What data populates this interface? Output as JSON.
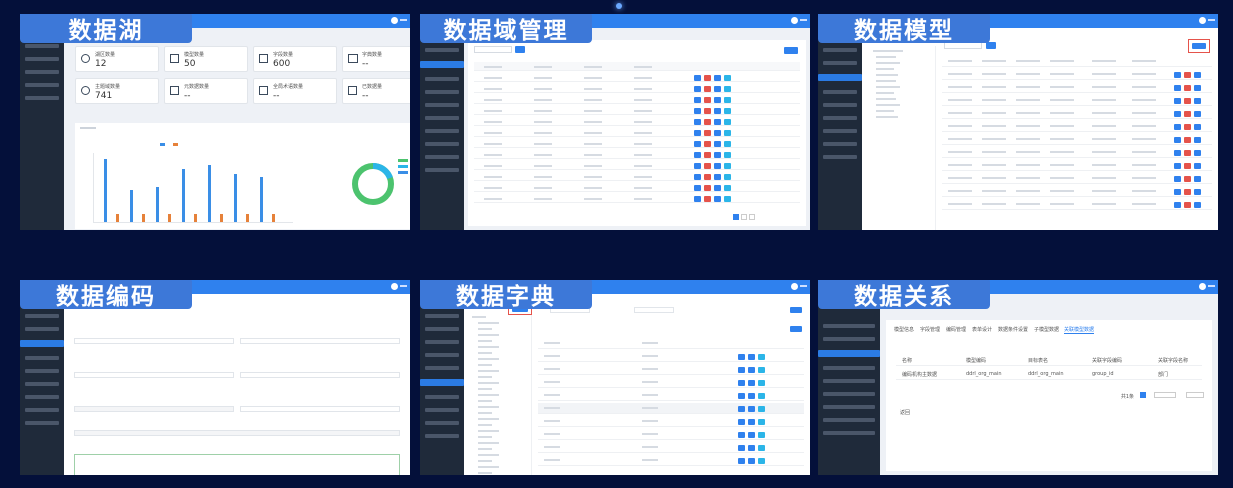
{
  "tiles": [
    {
      "caption": "数据湖",
      "stats": [
        {
          "label": "湖区数量",
          "value": "12"
        },
        {
          "label": "模型数量",
          "value": "50"
        },
        {
          "label": "字段数量",
          "value": "600"
        },
        {
          "label": "字典数量",
          "value": "--"
        },
        {
          "label": "主题域数量",
          "value": "741"
        },
        {
          "label": "元数据数量",
          "value": "--"
        },
        {
          "label": "全局术语数量",
          "value": "--"
        },
        {
          "label": "已数据量",
          "value": "--"
        }
      ],
      "chart_values": [
        0.9,
        0.45,
        0.5,
        0.75,
        0.82,
        0.68,
        0.64
      ]
    },
    {
      "caption": "数据域管理"
    },
    {
      "caption": "数据模型"
    },
    {
      "caption": "数据编码"
    },
    {
      "caption": "数据字典"
    },
    {
      "caption": "数据关系",
      "tabs": [
        "模型信息",
        "字段管理",
        "编码管理",
        "表单设计",
        "数据条件设置",
        "子模型数据",
        "关联模型数据"
      ],
      "headers": [
        "名称",
        "模型编码",
        "目标表名",
        "关联字段编码",
        "关联字段名称"
      ],
      "row": [
        "编码机构主数据",
        "ddrl_org_main",
        "ddrl_org_main",
        "group_id",
        "部门"
      ],
      "pager": "共1条",
      "back": "返回"
    }
  ]
}
